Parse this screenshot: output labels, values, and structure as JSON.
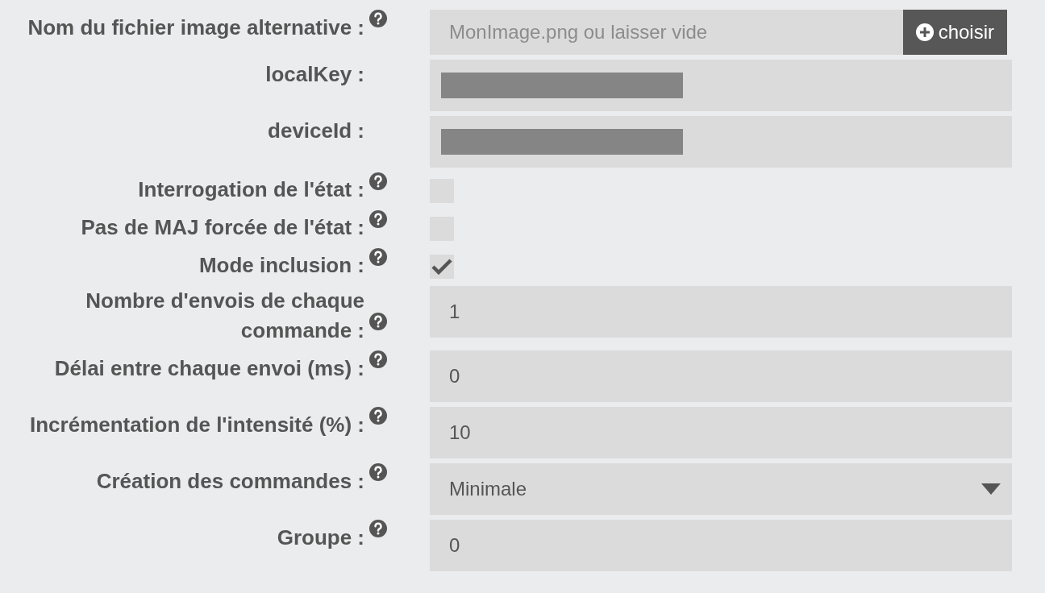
{
  "fields": [
    {
      "kind": "file",
      "label": "Nom du fichier image alternative :",
      "help": true,
      "placeholder": "MonImage.png ou laisser vide",
      "button": "choisir"
    },
    {
      "kind": "text",
      "label": "localKey :",
      "help": false,
      "redacted": true
    },
    {
      "kind": "text",
      "label": "deviceId :",
      "help": false,
      "redacted": true
    },
    {
      "kind": "checkbox",
      "label": "Interrogation de l'état :",
      "help": true,
      "checked": false
    },
    {
      "kind": "checkbox",
      "label": "Pas de MAJ forcée de l'état :",
      "help": true,
      "checked": false
    },
    {
      "kind": "checkbox",
      "label": "Mode inclusion :",
      "help": true,
      "checked": true
    },
    {
      "kind": "text",
      "label": "Nombre d'envois de chaque commande :",
      "help": true,
      "value": "1"
    },
    {
      "kind": "text",
      "label": "Délai entre chaque envoi (ms) :",
      "help": true,
      "value": "0"
    },
    {
      "kind": "text",
      "label": "Incrémentation de l'intensité (%) :",
      "help": true,
      "value": "10"
    },
    {
      "kind": "select",
      "label": "Création des commandes :",
      "help": true,
      "value": "Minimale"
    },
    {
      "kind": "text",
      "label": "Groupe :",
      "help": true,
      "value": "0"
    }
  ]
}
